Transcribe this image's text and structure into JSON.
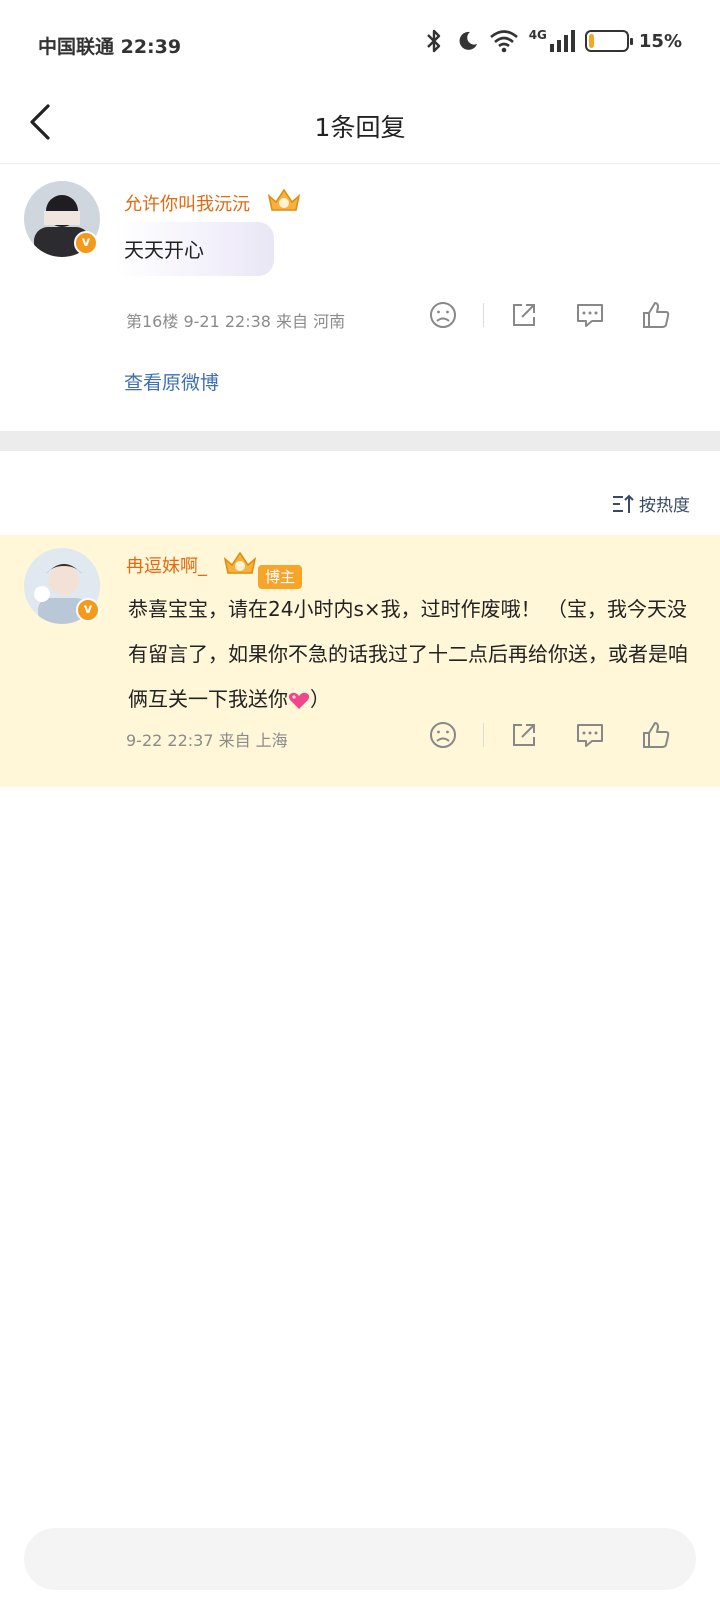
{
  "status": {
    "carrier_time": "中国联通 22:39",
    "network": "4G",
    "battery_percent": 15,
    "battery_label": "15%"
  },
  "nav": {
    "title": "1条回复"
  },
  "post": {
    "username": "允许你叫我沅沅",
    "text": "天天开心",
    "meta": "第16楼  9-21  22:38  来自  河南",
    "view_original": "查看原微博"
  },
  "sort": {
    "label": "按热度"
  },
  "reply": {
    "username": "冉逗妹啊_",
    "tag": "博主",
    "text": "恭喜宝宝，请在24小时内s×我，过时作废哦！ （宝，我今天没有留言了，如果你不急的话我过了十二点后再给你送，或者是咱俩互关一下我送你",
    "text_end": "）",
    "meta": "9-22  22:37  来自  上海"
  },
  "colors": {
    "accent_orange": "#e36a12",
    "link_blue": "#3f6fb5",
    "reply_bg": "#fff7d8"
  },
  "icons": [
    "back-arrow-icon",
    "bluetooth-icon",
    "moon-icon",
    "wifi-icon",
    "signal-icon",
    "battery-icon",
    "crown-badge-icon",
    "verified-badge-icon",
    "dislike-icon",
    "share-icon",
    "comment-icon",
    "like-icon",
    "sort-icon",
    "heart-emoji-icon"
  ]
}
